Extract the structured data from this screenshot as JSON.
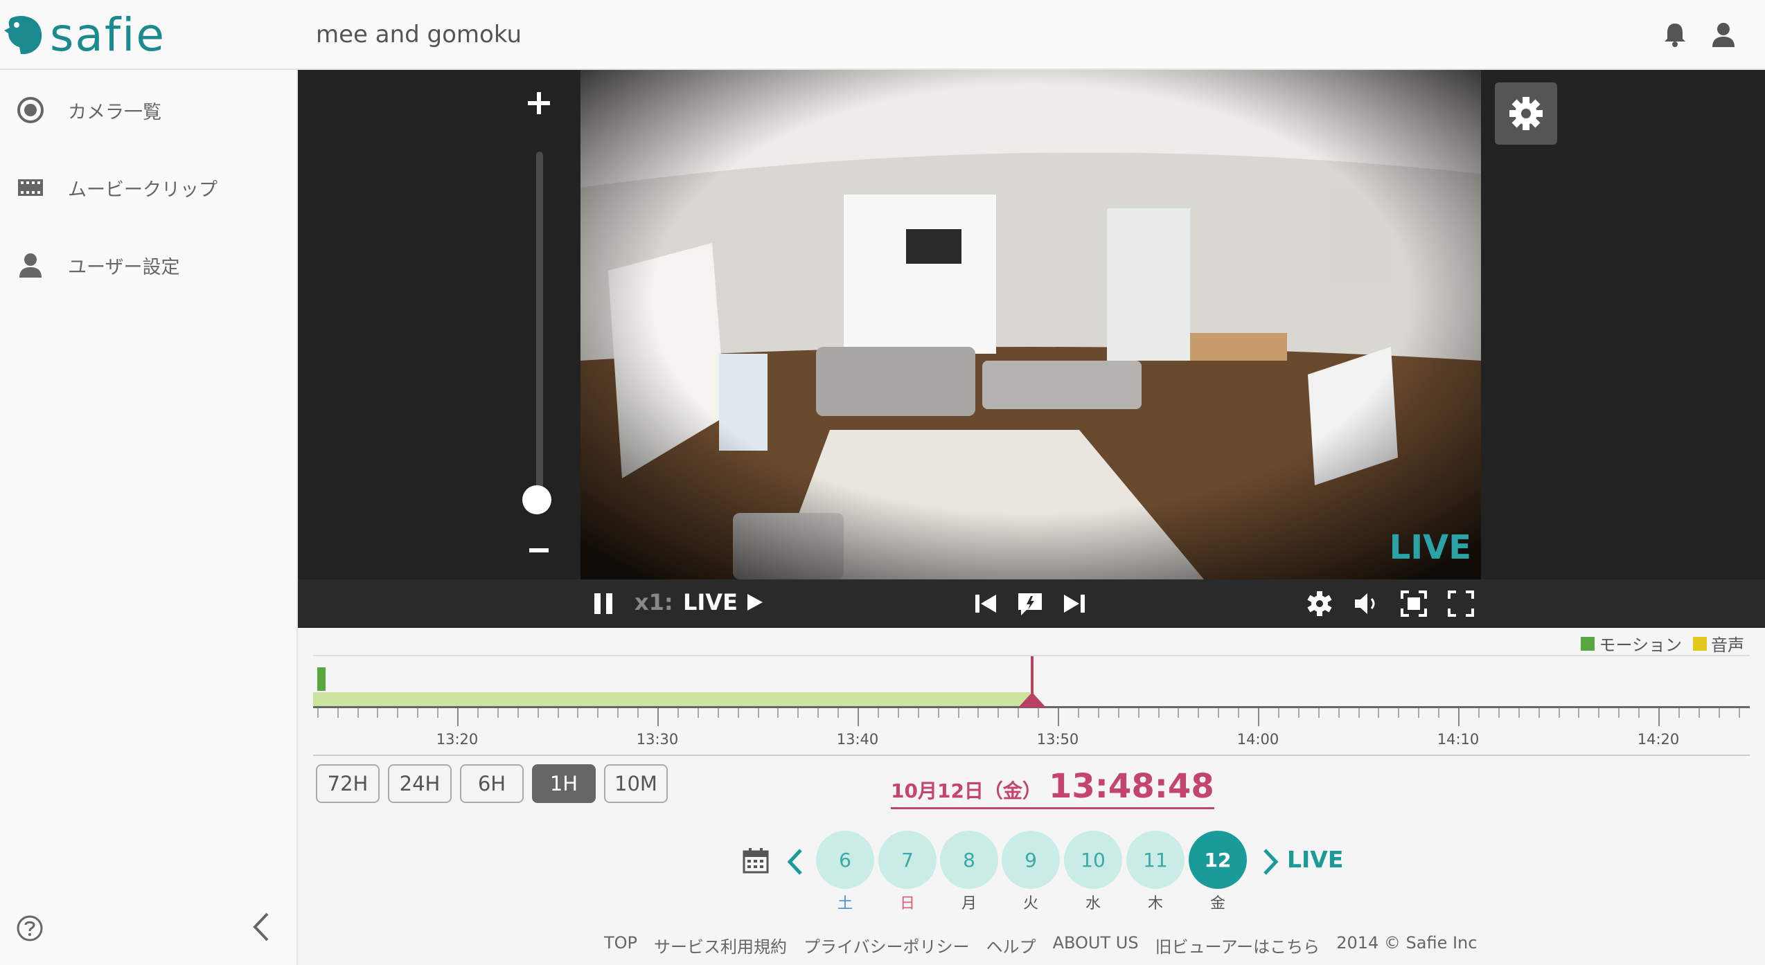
{
  "header": {
    "logo_text": "safie",
    "camera_title": "mee and gomoku",
    "icons": [
      "bell-icon",
      "user-icon"
    ]
  },
  "sidebar": {
    "items": [
      {
        "label": "カメラ一覧",
        "icon": "camera-icon"
      },
      {
        "label": "ムービークリップ",
        "icon": "film-icon"
      },
      {
        "label": "ユーザー設定",
        "icon": "person-icon"
      }
    ],
    "help_icon": "question-icon",
    "collapse_icon": "chevron-left-icon"
  },
  "player": {
    "live_badge": "LIVE",
    "speed_label": "x1:",
    "live_label": "LIVE",
    "zoom_level": 0.0
  },
  "timeline": {
    "legend": [
      {
        "label": "モーション",
        "color": "#5aa642"
      },
      {
        "label": "音声",
        "color": "#e1c61c"
      }
    ],
    "tick_labels": [
      "13:20",
      "13:30",
      "13:40",
      "13:50",
      "14:00",
      "14:10",
      "14:20"
    ],
    "ranges": [
      "72H",
      "24H",
      "6H",
      "1H",
      "10M"
    ],
    "active_range": "1H",
    "current_date": "10月12日（金）",
    "current_time": "13:48:48"
  },
  "date_picker": {
    "days": [
      {
        "num": "6",
        "dow": "土",
        "dow_color": "#4a90d9"
      },
      {
        "num": "7",
        "dow": "日",
        "dow_color": "#e05a7a"
      },
      {
        "num": "8",
        "dow": "月",
        "dow_color": "#555555"
      },
      {
        "num": "9",
        "dow": "火",
        "dow_color": "#555555"
      },
      {
        "num": "10",
        "dow": "水",
        "dow_color": "#555555"
      },
      {
        "num": "11",
        "dow": "木",
        "dow_color": "#555555"
      },
      {
        "num": "12",
        "dow": "金",
        "dow_color": "#555555"
      }
    ],
    "active_day": "12",
    "live_link": "LIVE"
  },
  "footer": {
    "links": [
      "TOP",
      "サービス利用規約",
      "プライバシーポリシー",
      "ヘルプ",
      "ABOUT US",
      "旧ビューアーはこちら"
    ],
    "copyright": "2014 © Safie Inc"
  },
  "colors": {
    "brand": "#1b8a8e",
    "accent_time": "#c44470",
    "active_day": "#1a9a98"
  }
}
